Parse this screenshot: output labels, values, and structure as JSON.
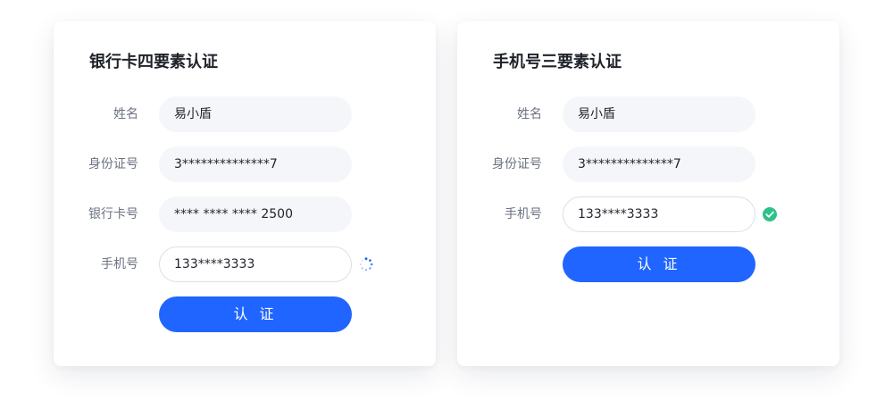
{
  "bank_card": {
    "title": "银行卡四要素认证",
    "fields": [
      {
        "label": "姓名",
        "value": "易小盾"
      },
      {
        "label": "身份证号",
        "value": "3**************7"
      },
      {
        "label": "银行卡号",
        "value": "**** **** **** 2500"
      },
      {
        "label": "手机号",
        "value": "133****3333"
      }
    ],
    "phone_status_icon": "loading-spinner-icon",
    "submit_label": "认 证"
  },
  "mobile": {
    "title": "手机号三要素认证",
    "fields": [
      {
        "label": "姓名",
        "value": "易小盾"
      },
      {
        "label": "身份证号",
        "value": "3**************7"
      },
      {
        "label": "手机号",
        "value": "133****3333"
      }
    ],
    "phone_status_icon": "check-circle-icon",
    "submit_label": "认 证"
  },
  "colors": {
    "primary": "#2065ff",
    "success": "#2ec28b",
    "input_bg": "#f5f6fa"
  }
}
